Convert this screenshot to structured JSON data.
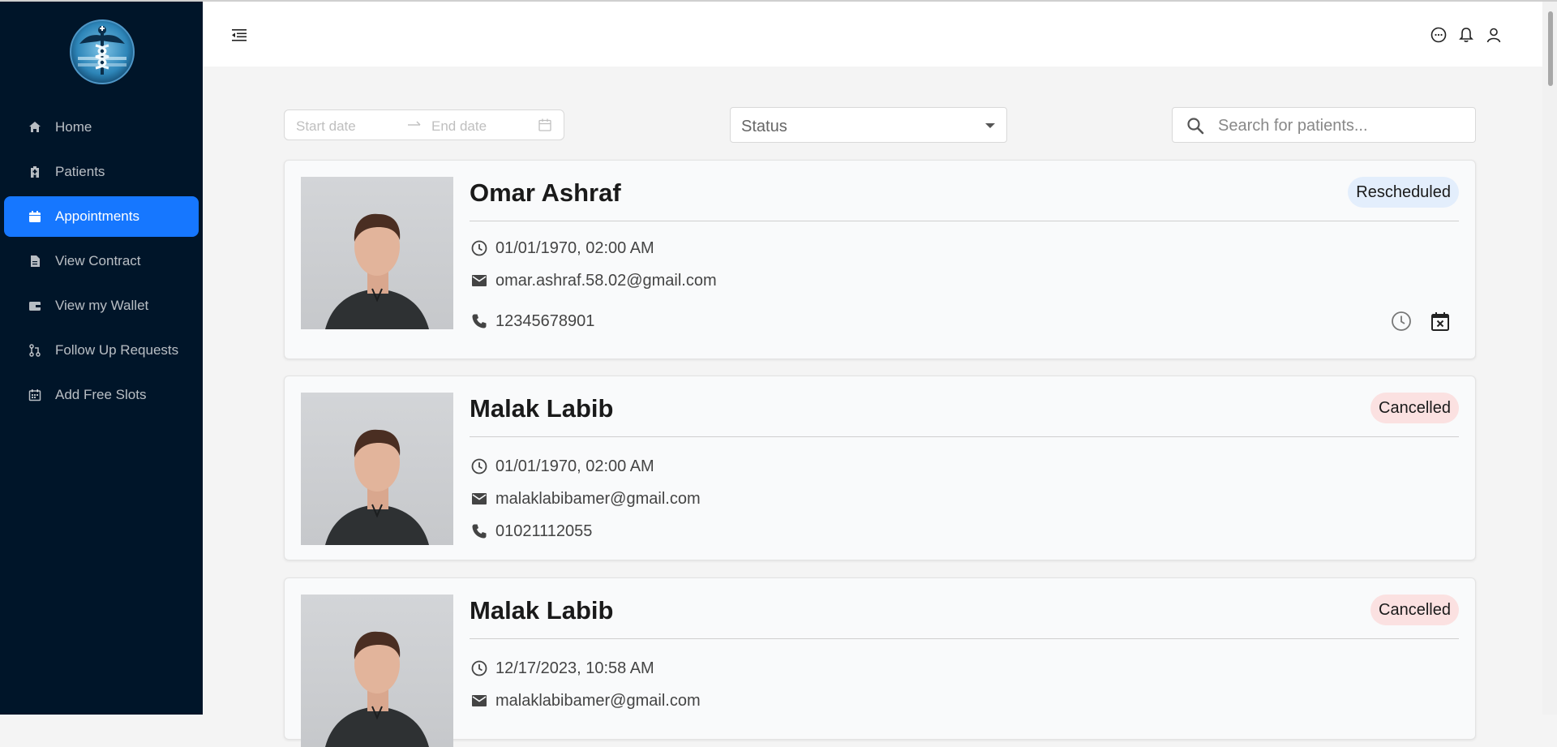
{
  "sidebar": {
    "items": [
      {
        "label": "Home",
        "icon": "home-icon"
      },
      {
        "label": "Patients",
        "icon": "hospital-icon"
      },
      {
        "label": "Appointments",
        "icon": "calendar-icon",
        "active": true
      },
      {
        "label": "View Contract",
        "icon": "document-icon"
      },
      {
        "label": "View my Wallet",
        "icon": "wallet-icon"
      },
      {
        "label": "Follow Up Requests",
        "icon": "pull-request-icon"
      },
      {
        "label": "Add Free Slots",
        "icon": "schedule-icon"
      }
    ]
  },
  "header": {
    "icons": [
      "menu-fold-icon",
      "message-icon",
      "bell-icon",
      "user-icon"
    ]
  },
  "filters": {
    "start_placeholder": "Start date",
    "end_placeholder": "End date",
    "status_placeholder": "Status",
    "search_placeholder": "Search for patients..."
  },
  "appointments": [
    {
      "name": "Omar Ashraf",
      "status": "Rescheduled",
      "datetime": "01/01/1970, 02:00 AM",
      "email": "omar.ashraf.58.02@gmail.com",
      "phone": "12345678901"
    },
    {
      "name": "Malak Labib",
      "status": "Cancelled",
      "datetime": "01/01/1970, 02:00 AM",
      "email": "malaklabibamer@gmail.com",
      "phone": "01021112055"
    },
    {
      "name": "Malak Labib",
      "status": "Cancelled",
      "datetime": "12/17/2023, 10:58 AM",
      "email": "malaklabibamer@gmail.com",
      "phone": ""
    }
  ],
  "colors": {
    "sidebar_bg": "#001529",
    "active_item": "#1677ff",
    "rescheduled_badge": "#e3eefc",
    "cancelled_badge": "#fbe1e1"
  }
}
